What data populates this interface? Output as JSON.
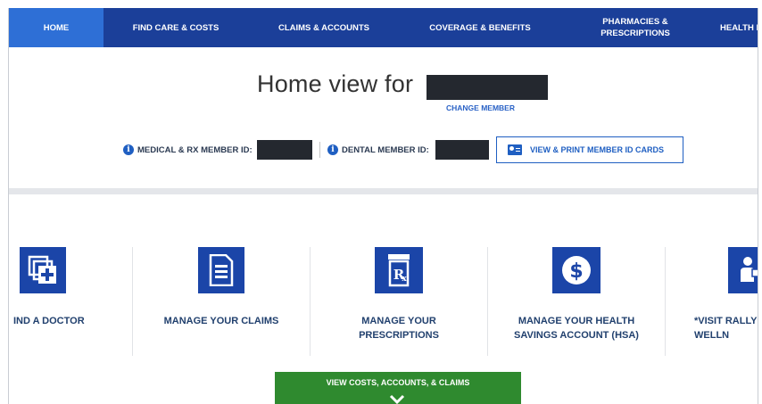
{
  "nav": {
    "items": [
      {
        "label": "HOME"
      },
      {
        "label": "FIND CARE & COSTS"
      },
      {
        "label": "CLAIMS & ACCOUNTS"
      },
      {
        "label": "COVERAGE & BENEFITS"
      },
      {
        "label": "PHARMACIES &\nPRESCRIPTIONS"
      },
      {
        "label": "HEALTH I"
      }
    ],
    "active_color": "#2e6fd6",
    "bar_color": "#1b3f99"
  },
  "header": {
    "title": "Home view for",
    "change_member": "CHANGE MEMBER"
  },
  "ids": {
    "medical_label": "MEDICAL & RX MEMBER ID:",
    "dental_label": "DENTAL MEMBER ID:",
    "info_glyph": "i",
    "view_cards": "VIEW & PRINT MEMBER ID CARDS"
  },
  "tiles": [
    {
      "label": "IND A DOCTOR",
      "icon": "find-doctor-icon"
    },
    {
      "label": "MANAGE YOUR CLAIMS",
      "icon": "claims-document-icon"
    },
    {
      "label": "MANAGE YOUR\nPRESCRIPTIONS",
      "icon": "rx-bottle-icon"
    },
    {
      "label": "MANAGE YOUR HEALTH\nSAVINGS ACCOUNT (HSA)",
      "icon": "dollar-icon"
    },
    {
      "label": "*VISIT RALLY\nWELLN",
      "icon": "wellness-person-icon"
    }
  ],
  "cta": {
    "label": "VIEW COSTS, ACCOUNTS, & CLAIMS",
    "color": "#2f8a2f"
  }
}
